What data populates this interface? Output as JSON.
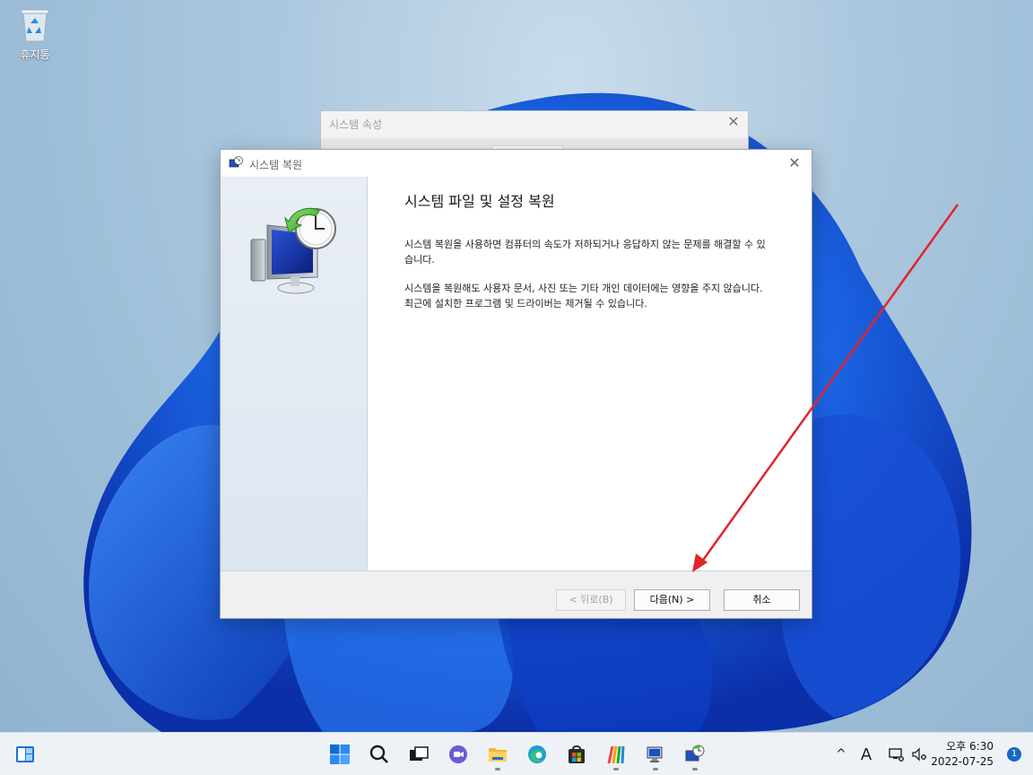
{
  "desktop": {
    "recycle_bin_label": "휴지통"
  },
  "background_window": {
    "title": "시스템 속성",
    "close_symbol": "✕"
  },
  "dialog": {
    "title": "시스템 복원",
    "close_symbol": "✕",
    "heading": "시스템 파일 및 설정 복원",
    "paragraphs": [
      "시스템 복원을 사용하면 컴퓨터의 속도가 저하되거나 응답하지 않는 문제를 해결할 수 있습니다.",
      "시스템을 복원해도 사용자 문서, 사진 또는 기타 개인 데이터에는 영향을 주지 않습니다. 최근에 설치한 프로그램 및 드라이버는 제거될 수 있습니다."
    ],
    "buttons": {
      "back": "< 뒤로(B)",
      "next": "다음(N) >",
      "cancel": "취소"
    }
  },
  "taskbar": {
    "icons": [
      "widgets-icon",
      "start-icon",
      "search-icon",
      "task-view-icon",
      "chat-icon",
      "file-explorer-icon",
      "edge-icon",
      "store-icon",
      "app-icon",
      "system-properties-icon",
      "system-restore-icon"
    ],
    "tray": {
      "chevron": "^",
      "ime": "A"
    },
    "clock": {
      "time": "오후 6:30",
      "date": "2022-07-25"
    },
    "notification_count": "1"
  },
  "colors": {
    "accent": "#1668c4",
    "annotation_arrow": "#e0242e",
    "wallpaper_blue": "#1b5fe0"
  }
}
